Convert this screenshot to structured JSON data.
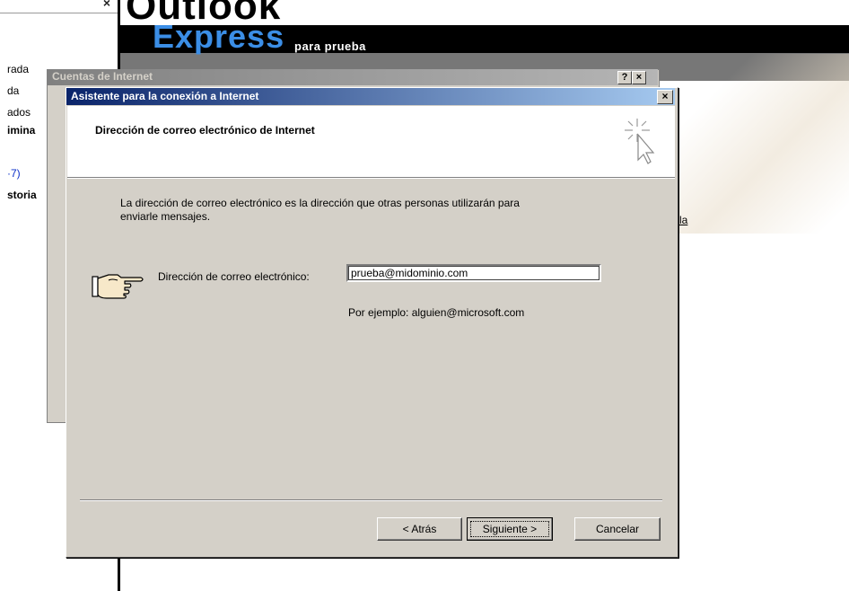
{
  "background_app": {
    "logo_line1": "Outlook",
    "logo_line2": "Express",
    "logo_subtitle": "para prueba",
    "left_pane": {
      "close_glyph": "×",
      "text_fragments": [
        "rada",
        "da",
        "ados",
        "imina",
        "·7)",
        "storia"
      ]
    },
    "partial_link": "la",
    "colors": {
      "express_blue": "#3b8ee6",
      "banner_black": "#000000"
    }
  },
  "accounts_window": {
    "title": "Cuentas de Internet",
    "help_glyph": "?",
    "close_glyph": "×"
  },
  "wizard": {
    "title": "Asistente para la conexión a Internet",
    "close_glyph": "×",
    "heading": "Dirección de correo electrónico de Internet",
    "header_icon": "cursor-sparkle-icon",
    "description_line1": "La dirección de correo electrónico es la dirección que otras personas utilizarán para",
    "description_line2": "enviarle mensajes.",
    "pointer_icon": "pointing-hand-icon",
    "email_label": "Dirección de correo electrónico:",
    "email_value": "prueba@midominio.com",
    "example_text": "Por ejemplo: alguien@microsoft.com",
    "buttons": {
      "back": "< Atrás",
      "next": "Siguiente >",
      "cancel": "Cancelar"
    },
    "colors": {
      "title_start": "#0a246a",
      "title_end": "#a6caf0",
      "face": "#d4d0c8"
    }
  }
}
